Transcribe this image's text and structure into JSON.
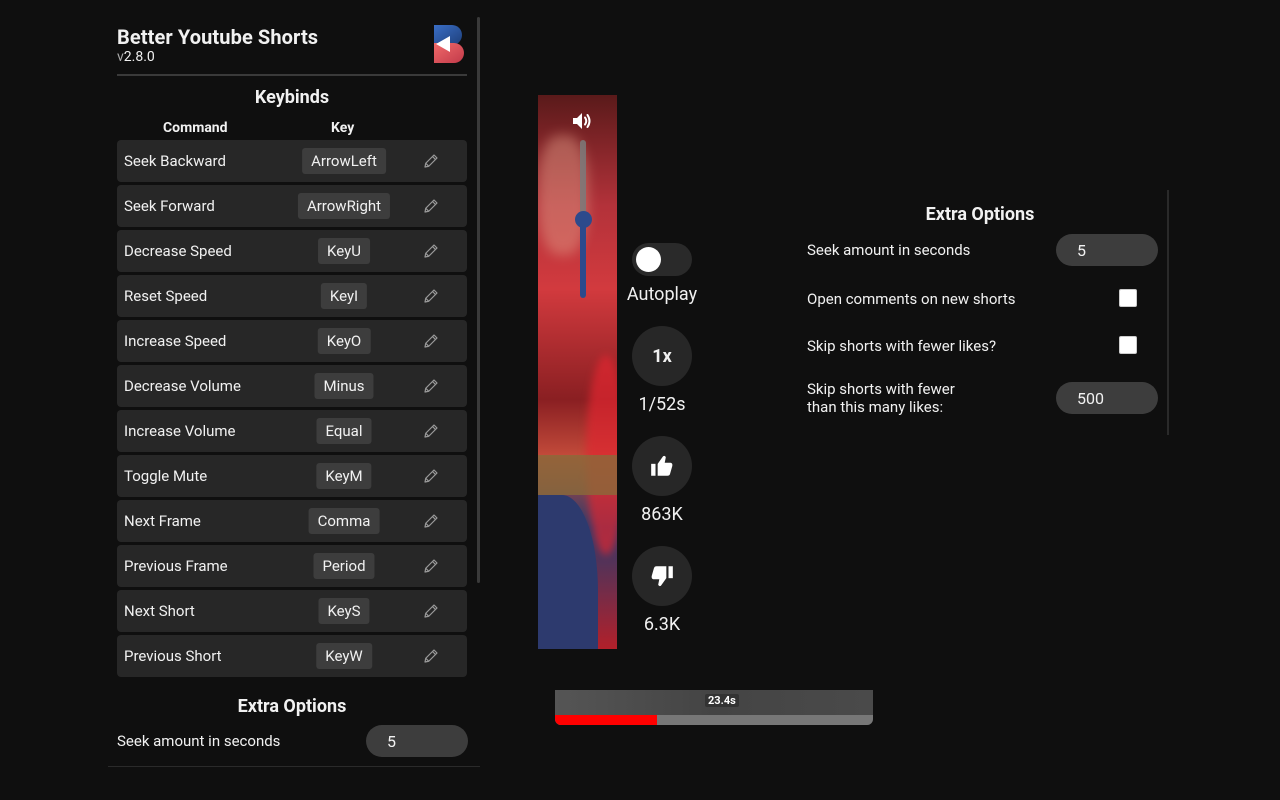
{
  "header": {
    "title": "Better Youtube Shorts",
    "version_prefix": "v",
    "version": "2.8.0"
  },
  "keybinds": {
    "title": "Keybinds",
    "col_command": "Command",
    "col_key": "Key",
    "rows": [
      {
        "command": "Seek Backward",
        "key": "ArrowLeft"
      },
      {
        "command": "Seek Forward",
        "key": "ArrowRight"
      },
      {
        "command": "Decrease Speed",
        "key": "KeyU"
      },
      {
        "command": "Reset Speed",
        "key": "KeyI"
      },
      {
        "command": "Increase Speed",
        "key": "KeyO"
      },
      {
        "command": "Decrease Volume",
        "key": "Minus"
      },
      {
        "command": "Increase Volume",
        "key": "Equal"
      },
      {
        "command": "Toggle Mute",
        "key": "KeyM"
      },
      {
        "command": "Next Frame",
        "key": "Comma"
      },
      {
        "command": "Previous Frame",
        "key": "Period"
      },
      {
        "command": "Next Short",
        "key": "KeyS"
      },
      {
        "command": "Previous Short",
        "key": "KeyW"
      }
    ]
  },
  "popup_extra": {
    "title": "Extra Options",
    "seek_label": "Seek amount in seconds",
    "seek_value": "5"
  },
  "player": {
    "volume_level": 0.5,
    "autoplay_label": "Autoplay",
    "autoplay_on": false,
    "speed_label": "1x",
    "time_label": "1/52s",
    "likes": "863K",
    "dislikes": "6.3K",
    "progress_time": "23.4s",
    "progress_fraction": 0.32,
    "accent_color": "#ff0000"
  },
  "extra_options": {
    "title": "Extra Options",
    "seek_label": "Seek amount in seconds",
    "seek_value": "5",
    "open_comments_label": "Open comments on new shorts",
    "open_comments_checked": false,
    "skip_fewer_likes_label": "Skip shorts with fewer likes?",
    "skip_fewer_likes_checked": false,
    "skip_threshold_label_line1": "Skip shorts with fewer",
    "skip_threshold_label_line2": "than this many likes:",
    "skip_threshold_value": "500"
  },
  "icons": {
    "edit": "pencil-icon",
    "volume": "volume-icon",
    "like": "thumbs-up-icon",
    "dislike": "thumbs-down-icon",
    "logo": "bys-logo-icon"
  }
}
